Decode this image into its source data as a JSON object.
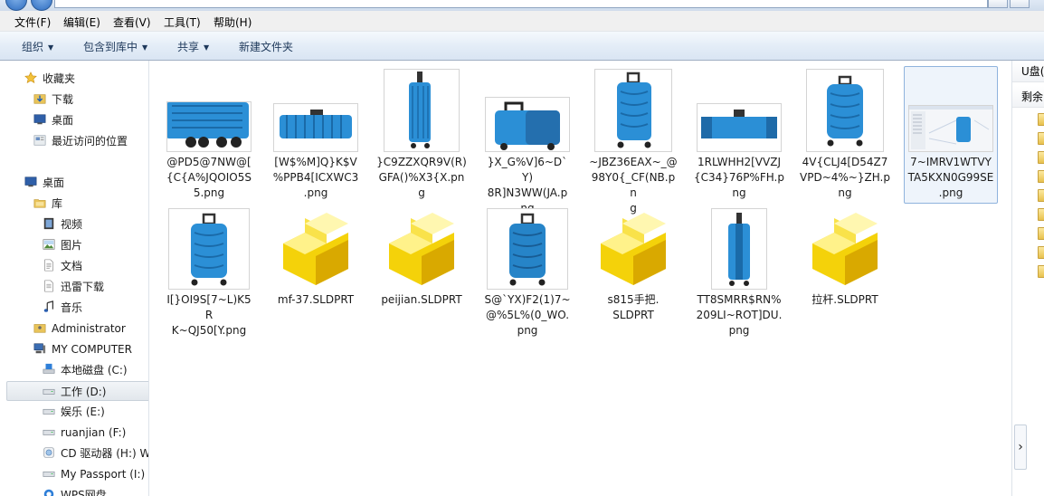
{
  "menu": [
    "文件(F)",
    "编辑(E)",
    "查看(V)",
    "工具(T)",
    "帮助(H)"
  ],
  "toolbar": {
    "organize": "组织",
    "include_library": "包含到库中",
    "share": "共享",
    "new_folder": "新建文件夹"
  },
  "nav": {
    "favorites": "收藏夹",
    "downloads": "下载",
    "desktop_fav": "桌面",
    "recent": "最近访问的位置",
    "desktop": "桌面",
    "libraries": "库",
    "videos": "视频",
    "pictures": "图片",
    "documents": "文档",
    "xunlei": "迅雷下载",
    "music": "音乐",
    "administrator": "Administrator",
    "computer": "MY COMPUTER",
    "drive_c": "本地磁盘 (C:)",
    "drive_d": "工作 (D:)",
    "drive_e": "娱乐 (E:)",
    "drive_f": "ruanjian (F:)",
    "drive_h": "CD 驱动器 (H:) W",
    "drive_i": "My Passport (I:)",
    "wps": "WPS网盘"
  },
  "files": [
    {
      "name": "@PD5@7NW@[{C{A%JQOIO5S5.png",
      "lines": [
        "@PD5@7NW@[",
        "{C{A%JQOIO5S",
        "5.png"
      ],
      "kind": "png",
      "view": "bottom"
    },
    {
      "name": "[W$%M]Q}K$V%PPB4[ICXWC3.png",
      "lines": [
        "[W$%M]Q}K$V",
        "%PPB4[ICXWC3",
        ".png"
      ],
      "kind": "png",
      "view": "flat"
    },
    {
      "name": "}C9ZZXQR9V(R)GFA()%X3{X.png",
      "lines": [
        "}C9ZZXQR9V(R)",
        "GFA()%X3{X.pn",
        "g"
      ],
      "kind": "png",
      "view": "side"
    },
    {
      "name": "}X_G%V]6~D`Y)8R]N3WW(JA.png",
      "lines": [
        "}X_G%V]6~D`Y)",
        "8R]N3WW(JA.p",
        "ng"
      ],
      "kind": "png",
      "view": "back"
    },
    {
      "name": "~JBZ36EAX~_@98Y0{_CF(NB.png",
      "lines": [
        "~JBZ36EAX~_@",
        "98Y0{_CF(NB.pn",
        "g"
      ],
      "kind": "png",
      "view": "front"
    },
    {
      "name": "1RLWHH2[VVZJ{C34}76P%FH.png",
      "lines": [
        "1RLWHH2[VVZJ",
        "{C34}76P%FH.p",
        "ng"
      ],
      "kind": "png",
      "view": "flat2"
    },
    {
      "name": "4V{CLJ4[D54Z7VPD~4%~}ZH.png",
      "lines": [
        "4V{CLJ4[D54Z7",
        "VPD~4%~}ZH.p",
        "ng"
      ],
      "kind": "png",
      "view": "front"
    },
    {
      "name": "7~IMRV1WTVYTA5KXN0G99SE.png",
      "lines": [
        "7~IMRV1WTVY",
        "TA5KXN0G99SE",
        ".png"
      ],
      "kind": "png",
      "view": "screen"
    },
    {
      "name": "I[}OI9S[7~L)K5RK~QJ50[Y.png",
      "lines": [
        "I[}OI9S[7~L)K5R",
        "K~QJ50[Y.png"
      ],
      "kind": "png",
      "view": "front"
    },
    {
      "name": "mf-37.SLDPRT",
      "lines": [
        "mf-37.SLDPRT"
      ],
      "kind": "sldprt"
    },
    {
      "name": "peijian.SLDPRT",
      "lines": [
        "peijian.SLDPRT"
      ],
      "kind": "sldprt"
    },
    {
      "name": "S@`YX)F2(1)7~@%5L%(0_WO.png",
      "lines": [
        "S@`YX)F2(1)7~",
        "@%5L%(0_WO.",
        "png"
      ],
      "kind": "png",
      "view": "front"
    },
    {
      "name": "s815手把.SLDPRT",
      "lines": [
        "s815手把.",
        "SLDPRT"
      ],
      "kind": "sldprt"
    },
    {
      "name": "TT8SMRR$RN%209LI~ROT]DU.png",
      "lines": [
        "TT8SMRR$RN%",
        "209LI~ROT]DU.",
        "png"
      ],
      "kind": "png",
      "view": "side"
    },
    {
      "name": "拉杆.SLDPRT",
      "lines": [
        "拉杆.SLDPRT"
      ],
      "kind": "sldprt"
    }
  ],
  "right_pane": {
    "title": "U盘(",
    "subtitle": "剩余"
  }
}
